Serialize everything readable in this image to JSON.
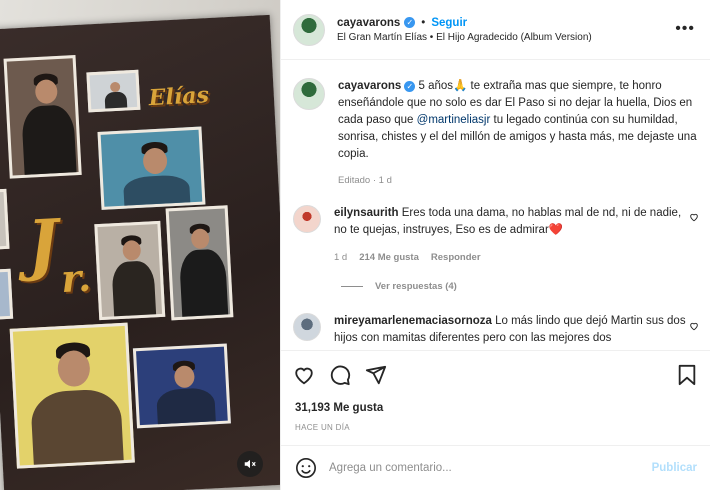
{
  "post": {
    "username": "cayavarons",
    "follow_label": "Seguir",
    "separator": "•",
    "audio": "El Gran Martín Elías • El Hijo Agradecido (Album Version)",
    "more_label": "•••"
  },
  "media": {
    "letters": [
      "Elías",
      "J",
      "r."
    ]
  },
  "caption": {
    "username": "cayavarons",
    "text_before": " 5 años🙏 te extraña mas que siempre, te honro enseñándole que no solo es dar El Paso si no dejar la huella, Dios en cada paso que ",
    "mention": "@martineliasjr",
    "text_after": " tu legado continúa con su humildad, sonrisa, chistes y el del millón de amigos y hasta más, me dejaste una copia.",
    "meta": "Editado · 1 d"
  },
  "comments": [
    {
      "username": "eilynsaurith",
      "text": " Eres toda una dama, no hablas mal de nd, ni de nadie, no te quejas, instruyes, Eso es de admirar❤️",
      "time": "1 d",
      "likes": "214 Me gusta",
      "reply_label": "Responder",
      "view_replies": "Ver respuestas (4)"
    },
    {
      "username": "mireyamarlenemaciasornoza",
      "text": " Lo más lindo que dejó Martin sus dos hijos con mamitas diferentes pero con las mejores dos"
    }
  ],
  "actions": {
    "likes_count": "31,193 Me gusta",
    "time_ago": "HACE UN DÍA"
  },
  "composer": {
    "placeholder": "Agrega un comentario...",
    "publish_label": "Publicar"
  },
  "colors": {
    "accent": "#0095f6",
    "verified": "#3897f0",
    "muted_text": "#8e8e8e",
    "publish_disabled": "#b2dffc"
  }
}
